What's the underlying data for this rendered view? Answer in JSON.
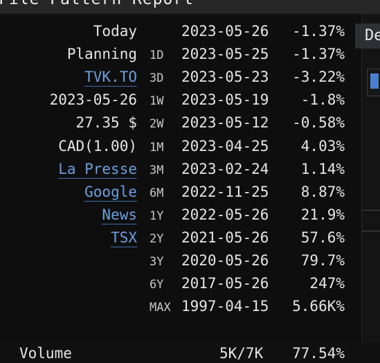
{
  "window": {
    "title": "File Pattern Report"
  },
  "labels": [
    {
      "text": "Today",
      "link": false
    },
    {
      "text": "Planning",
      "link": false
    },
    {
      "text": "TVK.TO",
      "link": true
    },
    {
      "text": "2023-05-26",
      "link": false
    },
    {
      "text": "27.35 $",
      "link": false
    },
    {
      "text": "CAD(1.00)",
      "link": false
    },
    {
      "text": "La Presse",
      "link": true
    },
    {
      "text": "Google",
      "link": true
    },
    {
      "text": "News",
      "link": true
    },
    {
      "text": "TSX",
      "link": true
    }
  ],
  "periods": [
    {
      "period": "",
      "date": "2023-05-26",
      "change": "-1.37%"
    },
    {
      "period": "1D",
      "date": "2023-05-25",
      "change": "-1.37%"
    },
    {
      "period": "3D",
      "date": "2023-05-23",
      "change": "-3.22%"
    },
    {
      "period": "1W",
      "date": "2023-05-19",
      "change": "-1.8%"
    },
    {
      "period": "2W",
      "date": "2023-05-12",
      "change": "-0.58%"
    },
    {
      "period": "1M",
      "date": "2023-04-25",
      "change": "4.03%"
    },
    {
      "period": "3M",
      "date": "2023-02-24",
      "change": "1.14%"
    },
    {
      "period": "6M",
      "date": "2022-11-25",
      "change": "8.87%"
    },
    {
      "period": "1Y",
      "date": "2022-05-26",
      "change": "21.9%"
    },
    {
      "period": "2Y",
      "date": "2021-05-26",
      "change": "57.6%"
    },
    {
      "period": "3Y",
      "date": "2020-05-26",
      "change": "79.7%"
    },
    {
      "period": "6Y",
      "date": "2017-05-26",
      "change": "247%"
    },
    {
      "period": "MAX",
      "date": "1997-04-15",
      "change": "5.66K%"
    }
  ],
  "footer": {
    "volume_label": "Volume",
    "volume_value": "5K/7K",
    "volume_pct": "77.54%"
  },
  "right_panel": {
    "tab_label": "De"
  },
  "colors": {
    "link": "#6c9fe0",
    "accent": "#4a7fcf"
  }
}
